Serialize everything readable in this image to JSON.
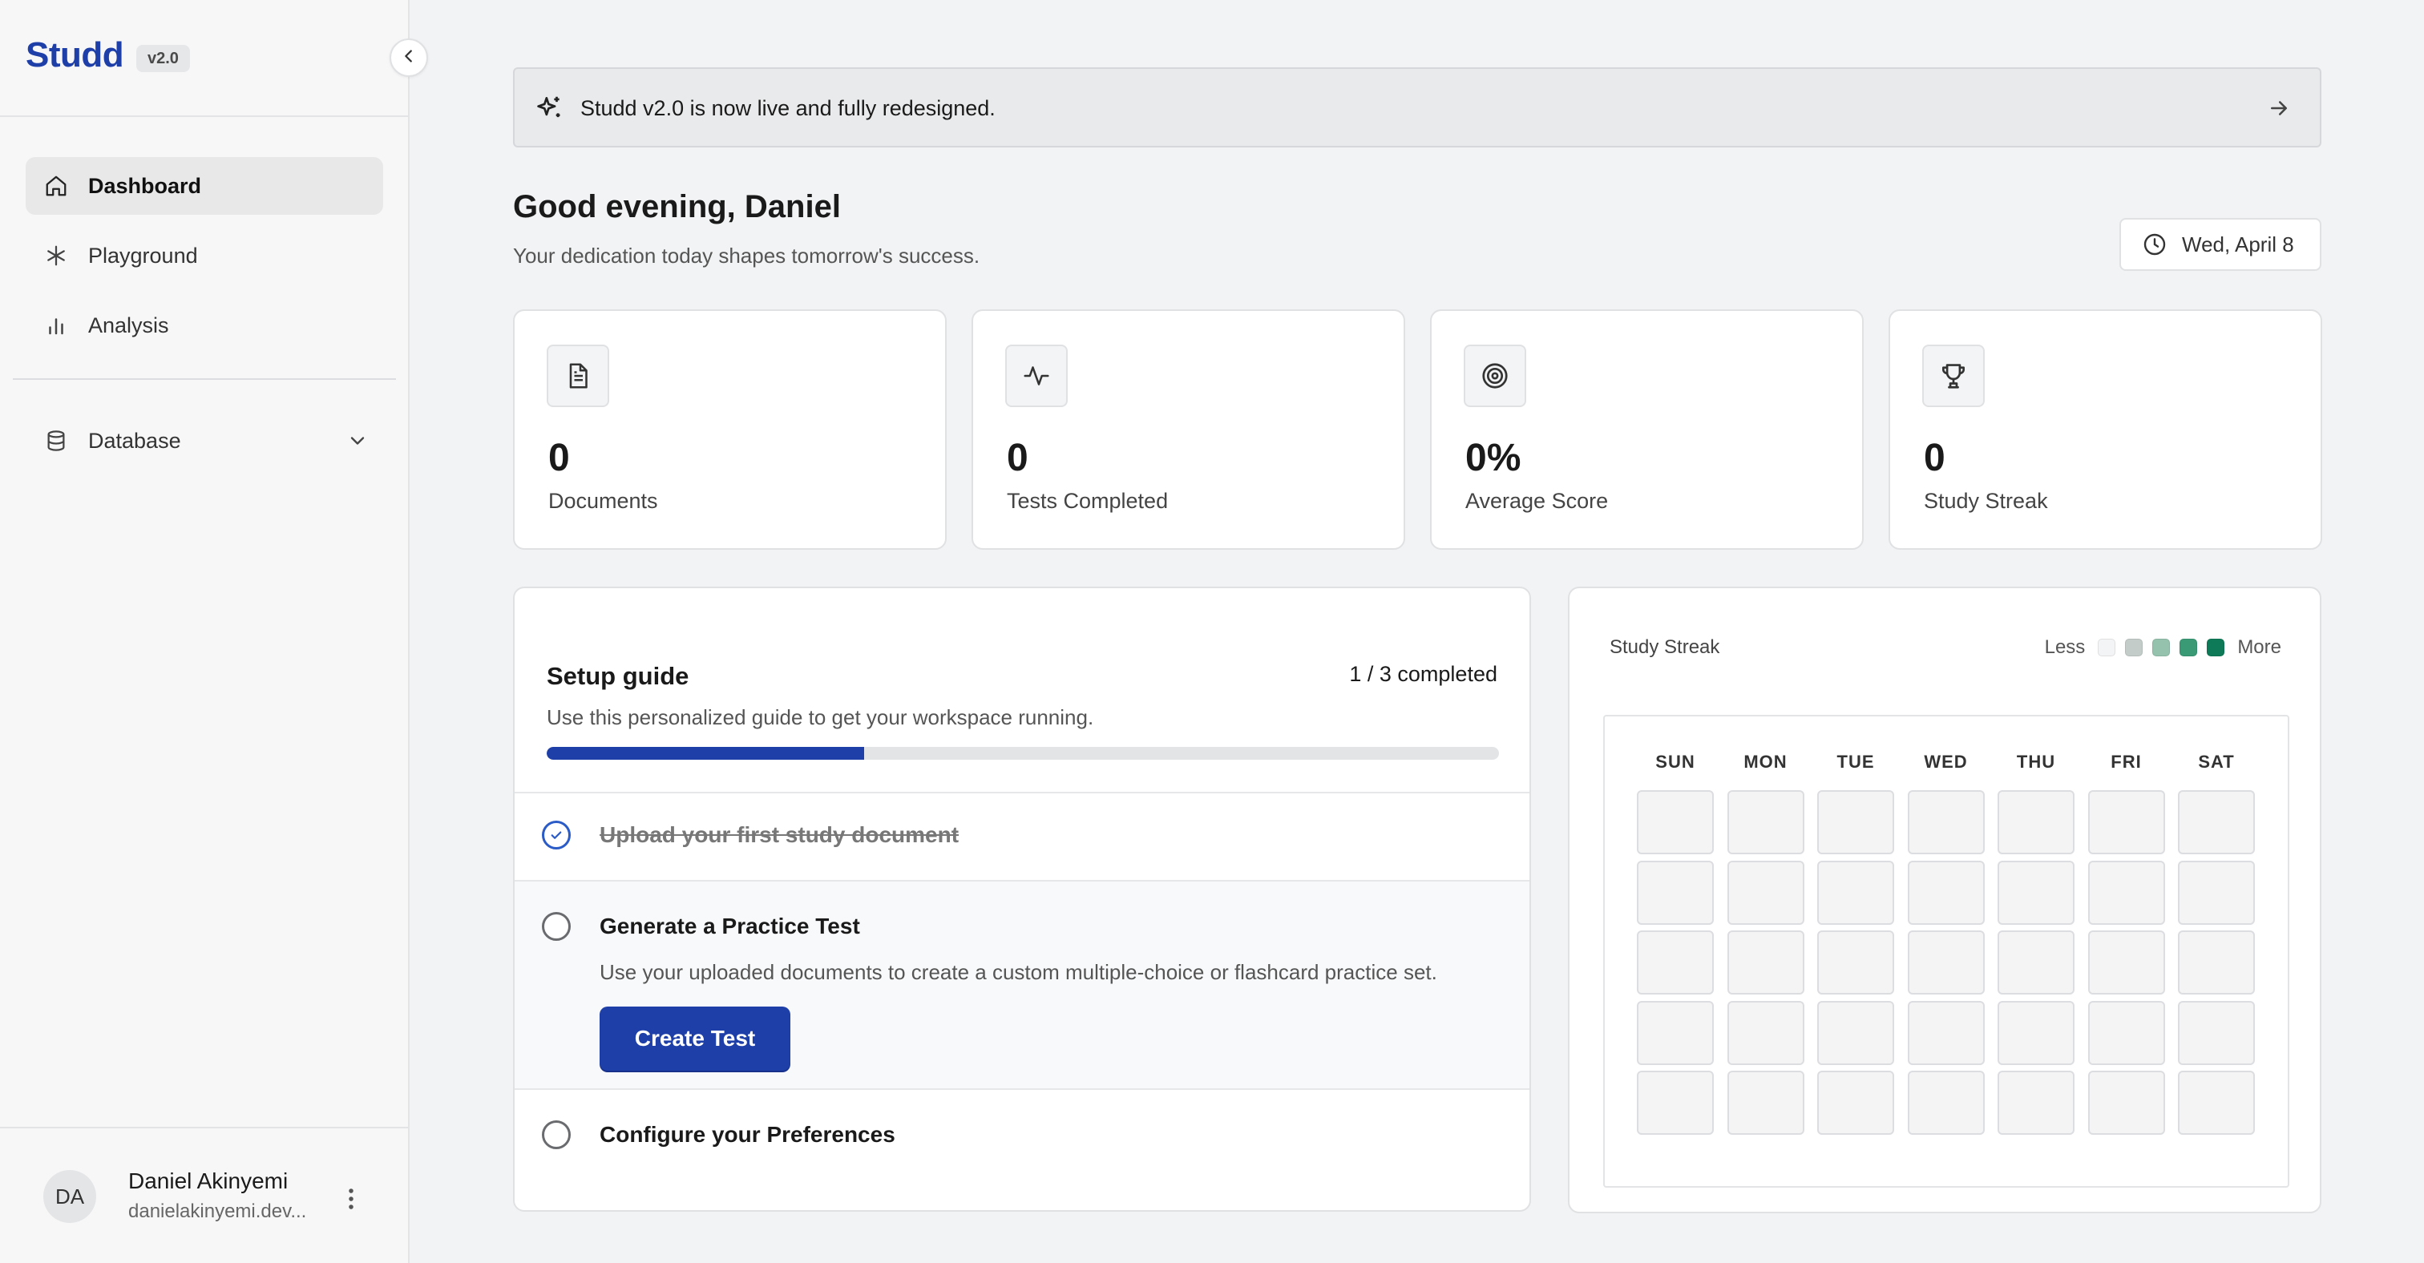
{
  "sidebar": {
    "brand": "Studd",
    "version": "v2.0",
    "items": [
      {
        "label": "Dashboard",
        "icon": "home-icon",
        "active": true
      },
      {
        "label": "Playground",
        "icon": "asterisk-icon",
        "active": false
      },
      {
        "label": "Analysis",
        "icon": "bar-chart-icon",
        "active": false
      }
    ],
    "database_label": "Database",
    "user": {
      "initials": "DA",
      "name": "Daniel Akinyemi",
      "email": "danielakinyemi.dev..."
    }
  },
  "announcement": {
    "text": "Studd v2.0 is now live and fully redesigned."
  },
  "header": {
    "greeting": "Good evening, Daniel",
    "subtitle": "Your dedication today shapes tomorrow's success.",
    "date": "Wed, April 8"
  },
  "stats": [
    {
      "value": "0",
      "label": "Documents",
      "icon": "document-icon"
    },
    {
      "value": "0",
      "label": "Tests Completed",
      "icon": "activity-icon"
    },
    {
      "value": "0%",
      "label": "Average Score",
      "icon": "target-icon"
    },
    {
      "value": "0",
      "label": "Study Streak",
      "icon": "trophy-icon"
    }
  ],
  "setup": {
    "title": "Setup guide",
    "progress_text": "1 / 3 completed",
    "progress": 0.333,
    "description": "Use this personalized guide to get your workspace running.",
    "steps": [
      {
        "title": "Upload your first study document",
        "done": true
      },
      {
        "title": "Generate a Practice Test",
        "done": false,
        "description": "Use your uploaded documents to create a custom multiple-choice or flashcard practice set.",
        "button": "Create Test"
      },
      {
        "title": "Configure your Preferences",
        "done": false
      }
    ]
  },
  "streak": {
    "title": "Study Streak",
    "legend_less": "Less",
    "legend_more": "More",
    "legend_colors": [
      "#f3f4f5",
      "#c3ccc8",
      "#94c2ad",
      "#3b9a76",
      "#0f7a57"
    ],
    "days": [
      "SUN",
      "MON",
      "TUE",
      "WED",
      "THU",
      "FRI",
      "SAT"
    ],
    "weeks": 5
  }
}
